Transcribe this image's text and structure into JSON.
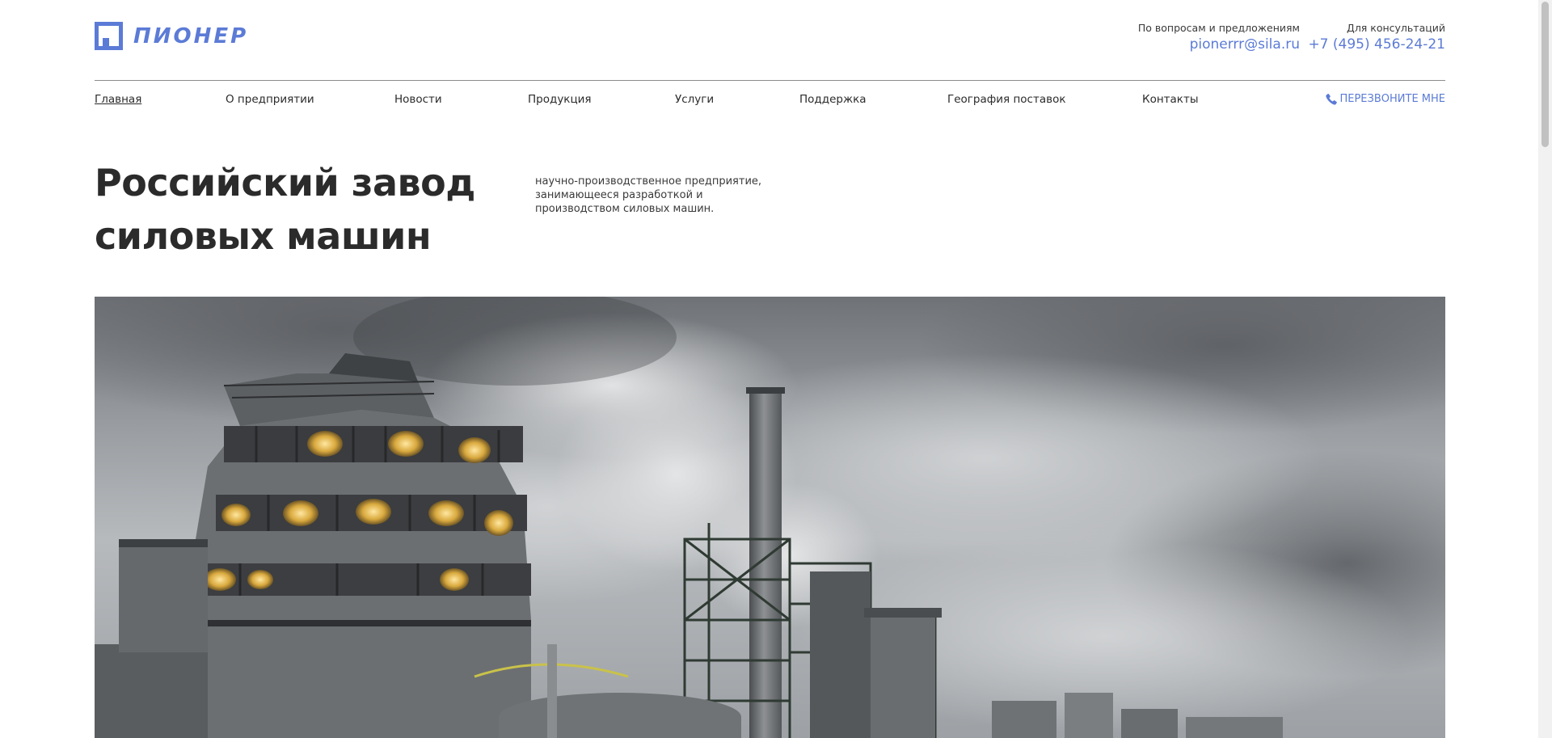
{
  "brand": {
    "name": "ПИОНЕР",
    "color": "#5b7bd6"
  },
  "header": {
    "email_label": "По вопросам и предложениям",
    "email": "pionerrr@sila.ru",
    "phone_label": "Для консультаций",
    "phone": "+7 (495) 456-24-21"
  },
  "nav": {
    "items": [
      {
        "label": "Главная",
        "active": true
      },
      {
        "label": "О предприятии"
      },
      {
        "label": "Новости"
      },
      {
        "label": "Продукция"
      },
      {
        "label": "Услуги"
      },
      {
        "label": "Поддержка"
      },
      {
        "label": "География поставок"
      },
      {
        "label": "Контакты"
      }
    ],
    "callback_label": "ПЕРЕЗВОНИТЕ МНЕ",
    "callback_icon": "phone-icon"
  },
  "hero": {
    "title_line1": "Российский завод",
    "title_line2": "силовых машин",
    "description": "научно-производственное предприятие, занимающееся разработкой и производством силовых машин.",
    "image_alt": "industrial-plant-photo"
  },
  "colors": {
    "accent": "#5b7bd6",
    "text": "#2b2b2b",
    "divider": "#8c8c8c"
  }
}
